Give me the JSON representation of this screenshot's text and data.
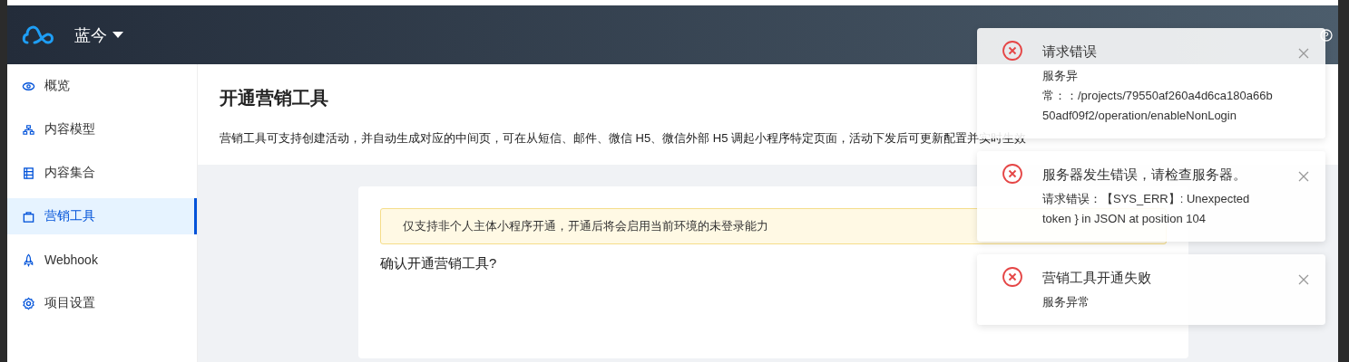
{
  "header": {
    "project": "蓝今"
  },
  "sidebar": {
    "items": [
      {
        "label": "概览",
        "selected": false
      },
      {
        "label": "内容模型",
        "selected": false
      },
      {
        "label": "内容集合",
        "selected": false
      },
      {
        "label": "营销工具",
        "selected": true
      },
      {
        "label": "Webhook",
        "selected": false
      },
      {
        "label": "项目设置",
        "selected": false
      }
    ]
  },
  "page": {
    "title": "开通营销工具",
    "description": "营销工具可支持创建活动，并自动生成对应的中间页，可在从短信、邮件、微信 H5、微信外部 H5 调起小程序特定页面，活动下发后可更新配置并实时生效"
  },
  "card": {
    "notice": "仅支持非个人主体小程序开通，开通后将会启用当前环境的未登录能力",
    "question": "确认开通营销工具?"
  },
  "notifications": [
    {
      "kind": "error",
      "title": "请求错误",
      "message": "服务异常：：/projects/79550af260a4d6ca180a66b50adf09f2/operation/enableNonLogin"
    },
    {
      "kind": "error",
      "title": "服务器发生错误，请检查服务器。",
      "message": "请求错误：【SYS_ERR】: Unexpected token } in JSON at position 104"
    },
    {
      "kind": "error",
      "title": "营销工具开通失败",
      "message": "服务异常"
    }
  ]
}
